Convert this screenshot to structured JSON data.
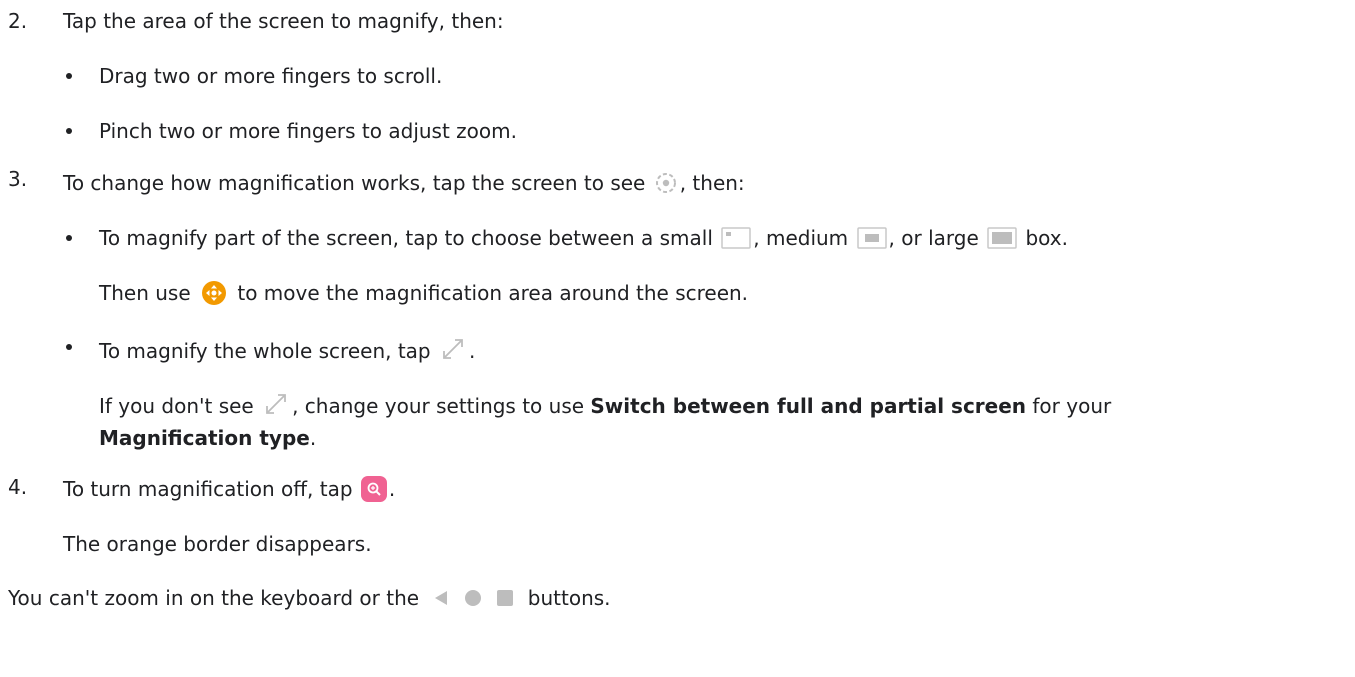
{
  "steps": {
    "s2": {
      "num": "2.",
      "text": "Tap the area of the screen to magnify, then:",
      "b1": "Drag two or more fingers to scroll.",
      "b2": "Pinch two or more fingers to adjust zoom."
    },
    "s3": {
      "num": "3.",
      "text_a": "To change how magnification works, tap the screen to see ",
      "text_b": ", then:",
      "b1_a": "To magnify part of the screen, tap to choose between a small ",
      "b1_b": ", medium ",
      "b1_c": ", or large ",
      "b1_d": " box.",
      "p1_a": "Then use ",
      "p1_b": " to move the magnification area around the screen.",
      "b2_a": "To magnify the whole screen, tap ",
      "b2_b": ".",
      "p2_a": "If you don't see ",
      "p2_b": ", change your settings to use ",
      "p2_bold1": "Switch between full and partial screen",
      "p2_c": " for your",
      "p2_bold2": "Magnification type",
      "p2_d": "."
    },
    "s4": {
      "num": "4.",
      "text_a": "To turn magnification off, tap ",
      "text_b": ".",
      "p1": "The orange border disappears."
    }
  },
  "footer": {
    "text_a": "You can't zoom in on the keyboard or the ",
    "text_b": " buttons."
  },
  "icons": {
    "settings": "magnification-settings-gear-icon",
    "small_box": "small-box-icon",
    "medium_box": "medium-box-icon",
    "large_box": "large-box-icon",
    "move": "move-magnification-icon",
    "expand": "full-screen-expand-icon",
    "magnification_off": "magnification-off-icon",
    "back": "back-triangle-icon",
    "home": "home-circle-icon",
    "recents": "recents-square-icon"
  },
  "colors": {
    "text": "#202124",
    "move_icon": "#f29900",
    "magnification_off_icon": "#f06292",
    "icon_gray": "#bdbdbd"
  }
}
